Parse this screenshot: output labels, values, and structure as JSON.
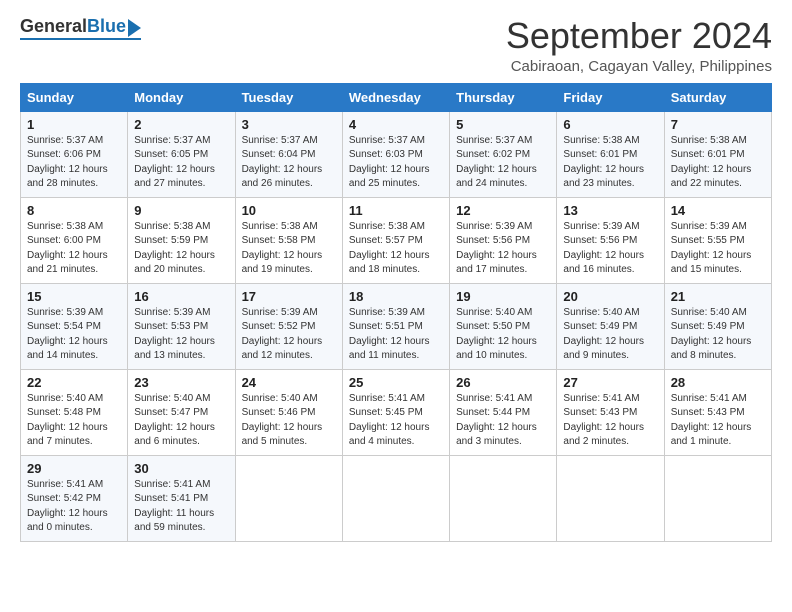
{
  "header": {
    "logo_general": "General",
    "logo_blue": "Blue",
    "month_title": "September 2024",
    "location": "Cabiraoan, Cagayan Valley, Philippines"
  },
  "calendar": {
    "headers": [
      "Sunday",
      "Monday",
      "Tuesday",
      "Wednesday",
      "Thursday",
      "Friday",
      "Saturday"
    ],
    "weeks": [
      [
        null,
        {
          "day": "2",
          "sunrise": "5:37 AM",
          "sunset": "6:05 PM",
          "daylight": "12 hours and 27 minutes."
        },
        {
          "day": "3",
          "sunrise": "5:37 AM",
          "sunset": "6:04 PM",
          "daylight": "12 hours and 26 minutes."
        },
        {
          "day": "4",
          "sunrise": "5:37 AM",
          "sunset": "6:03 PM",
          "daylight": "12 hours and 25 minutes."
        },
        {
          "day": "5",
          "sunrise": "5:37 AM",
          "sunset": "6:02 PM",
          "daylight": "12 hours and 24 minutes."
        },
        {
          "day": "6",
          "sunrise": "5:38 AM",
          "sunset": "6:01 PM",
          "daylight": "12 hours and 23 minutes."
        },
        {
          "day": "7",
          "sunrise": "5:38 AM",
          "sunset": "6:01 PM",
          "daylight": "12 hours and 22 minutes."
        }
      ],
      [
        {
          "day": "1",
          "sunrise": "5:37 AM",
          "sunset": "6:06 PM",
          "daylight": "12 hours and 28 minutes."
        },
        {
          "day": "9",
          "sunrise": "5:38 AM",
          "sunset": "5:59 PM",
          "daylight": "12 hours and 20 minutes."
        },
        {
          "day": "10",
          "sunrise": "5:38 AM",
          "sunset": "5:58 PM",
          "daylight": "12 hours and 19 minutes."
        },
        {
          "day": "11",
          "sunrise": "5:38 AM",
          "sunset": "5:57 PM",
          "daylight": "12 hours and 18 minutes."
        },
        {
          "day": "12",
          "sunrise": "5:39 AM",
          "sunset": "5:56 PM",
          "daylight": "12 hours and 17 minutes."
        },
        {
          "day": "13",
          "sunrise": "5:39 AM",
          "sunset": "5:56 PM",
          "daylight": "12 hours and 16 minutes."
        },
        {
          "day": "14",
          "sunrise": "5:39 AM",
          "sunset": "5:55 PM",
          "daylight": "12 hours and 15 minutes."
        }
      ],
      [
        {
          "day": "8",
          "sunrise": "5:38 AM",
          "sunset": "6:00 PM",
          "daylight": "12 hours and 21 minutes."
        },
        {
          "day": "16",
          "sunrise": "5:39 AM",
          "sunset": "5:53 PM",
          "daylight": "12 hours and 13 minutes."
        },
        {
          "day": "17",
          "sunrise": "5:39 AM",
          "sunset": "5:52 PM",
          "daylight": "12 hours and 12 minutes."
        },
        {
          "day": "18",
          "sunrise": "5:39 AM",
          "sunset": "5:51 PM",
          "daylight": "12 hours and 11 minutes."
        },
        {
          "day": "19",
          "sunrise": "5:40 AM",
          "sunset": "5:50 PM",
          "daylight": "12 hours and 10 minutes."
        },
        {
          "day": "20",
          "sunrise": "5:40 AM",
          "sunset": "5:49 PM",
          "daylight": "12 hours and 9 minutes."
        },
        {
          "day": "21",
          "sunrise": "5:40 AM",
          "sunset": "5:49 PM",
          "daylight": "12 hours and 8 minutes."
        }
      ],
      [
        {
          "day": "15",
          "sunrise": "5:39 AM",
          "sunset": "5:54 PM",
          "daylight": "12 hours and 14 minutes."
        },
        {
          "day": "23",
          "sunrise": "5:40 AM",
          "sunset": "5:47 PM",
          "daylight": "12 hours and 6 minutes."
        },
        {
          "day": "24",
          "sunrise": "5:40 AM",
          "sunset": "5:46 PM",
          "daylight": "12 hours and 5 minutes."
        },
        {
          "day": "25",
          "sunrise": "5:41 AM",
          "sunset": "5:45 PM",
          "daylight": "12 hours and 4 minutes."
        },
        {
          "day": "26",
          "sunrise": "5:41 AM",
          "sunset": "5:44 PM",
          "daylight": "12 hours and 3 minutes."
        },
        {
          "day": "27",
          "sunrise": "5:41 AM",
          "sunset": "5:43 PM",
          "daylight": "12 hours and 2 minutes."
        },
        {
          "day": "28",
          "sunrise": "5:41 AM",
          "sunset": "5:43 PM",
          "daylight": "12 hours and 1 minute."
        }
      ],
      [
        {
          "day": "22",
          "sunrise": "5:40 AM",
          "sunset": "5:48 PM",
          "daylight": "12 hours and 7 minutes."
        },
        {
          "day": "30",
          "sunrise": "5:41 AM",
          "sunset": "5:41 PM",
          "daylight": "11 hours and 59 minutes."
        },
        null,
        null,
        null,
        null,
        null
      ],
      [
        {
          "day": "29",
          "sunrise": "5:41 AM",
          "sunset": "5:42 PM",
          "daylight": "12 hours and 0 minutes."
        },
        null,
        null,
        null,
        null,
        null,
        null
      ]
    ]
  }
}
